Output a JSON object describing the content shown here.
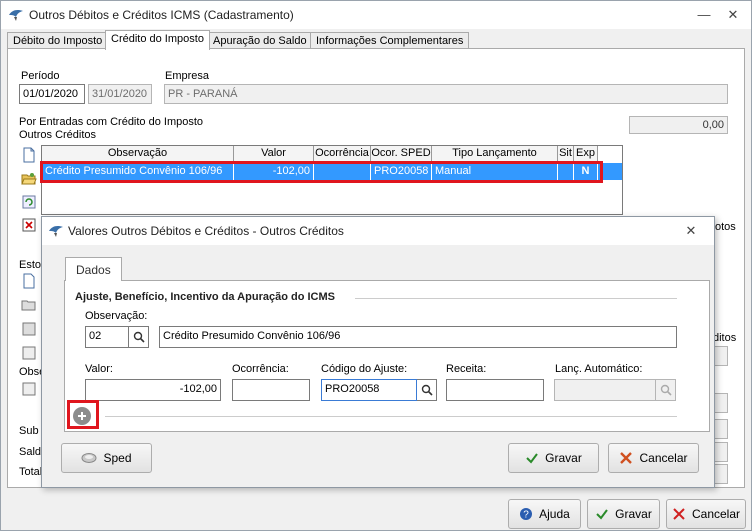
{
  "window": {
    "title": "Outros Débitos e Créditos ICMS (Cadastramento)"
  },
  "tabs": [
    "Débito do Imposto",
    "Crédito do Imposto",
    "Apuração do Saldo",
    "Informações Complementares"
  ],
  "periodo": {
    "label": "Período",
    "start": "01/01/2020",
    "end": "31/01/2020"
  },
  "empresa": {
    "label": "Empresa",
    "value": "PR - PARANÁ"
  },
  "section": {
    "line1": "Por Entradas com Crédito do Imposto",
    "line2": "Outros Créditos"
  },
  "total_box": "0,00",
  "grid": {
    "headers": [
      "Observação",
      "Valor",
      "Ocorrência",
      "Ocor. SPED",
      "Tipo Lançamento",
      "Sit",
      "Exp"
    ],
    "rows": [
      {
        "observacao": "Crédito Presumido Convênio 106/96",
        "valor": "-102,00",
        "ocorrencia": "",
        "ocor_sped": "PRO20058",
        "tipo": "Manual",
        "sit": "",
        "exp": "N"
      }
    ]
  },
  "behind_labels": {
    "estor": "Estor",
    "obse": "Obse",
    "sub": "Sub T",
    "saldo": "Saldo",
    "total": "Total",
    "otos1": "otos",
    "otos2": "ditos"
  },
  "dialog": {
    "title": "Valores Outros Débitos e Créditos - Outros Créditos",
    "tab": "Dados",
    "section": "Ajuste, Benefício, Incentivo da Apuração do ICMS",
    "observacao": {
      "label": "Observação:",
      "code": "02",
      "desc": "Crédito Presumido Convênio 106/96"
    },
    "valor": {
      "label": "Valor:",
      "value": "-102,00"
    },
    "ocorrencia": {
      "label": "Ocorrência:",
      "value": ""
    },
    "codigo_ajuste": {
      "label": "Código do Ajuste:",
      "value": "PRO20058"
    },
    "receita": {
      "label": "Receita:",
      "value": ""
    },
    "lanc_auto": {
      "label": "Lanç. Automático:",
      "value": ""
    },
    "buttons": {
      "sped": "Sped",
      "gravar": "Gravar",
      "cancelar": "Cancelar"
    }
  },
  "footer": {
    "ajuda": "Ajuda",
    "gravar": "Gravar",
    "cancelar": "Cancelar"
  },
  "colors": {
    "selection": "#3399ff",
    "highlight": "#e0161e"
  }
}
